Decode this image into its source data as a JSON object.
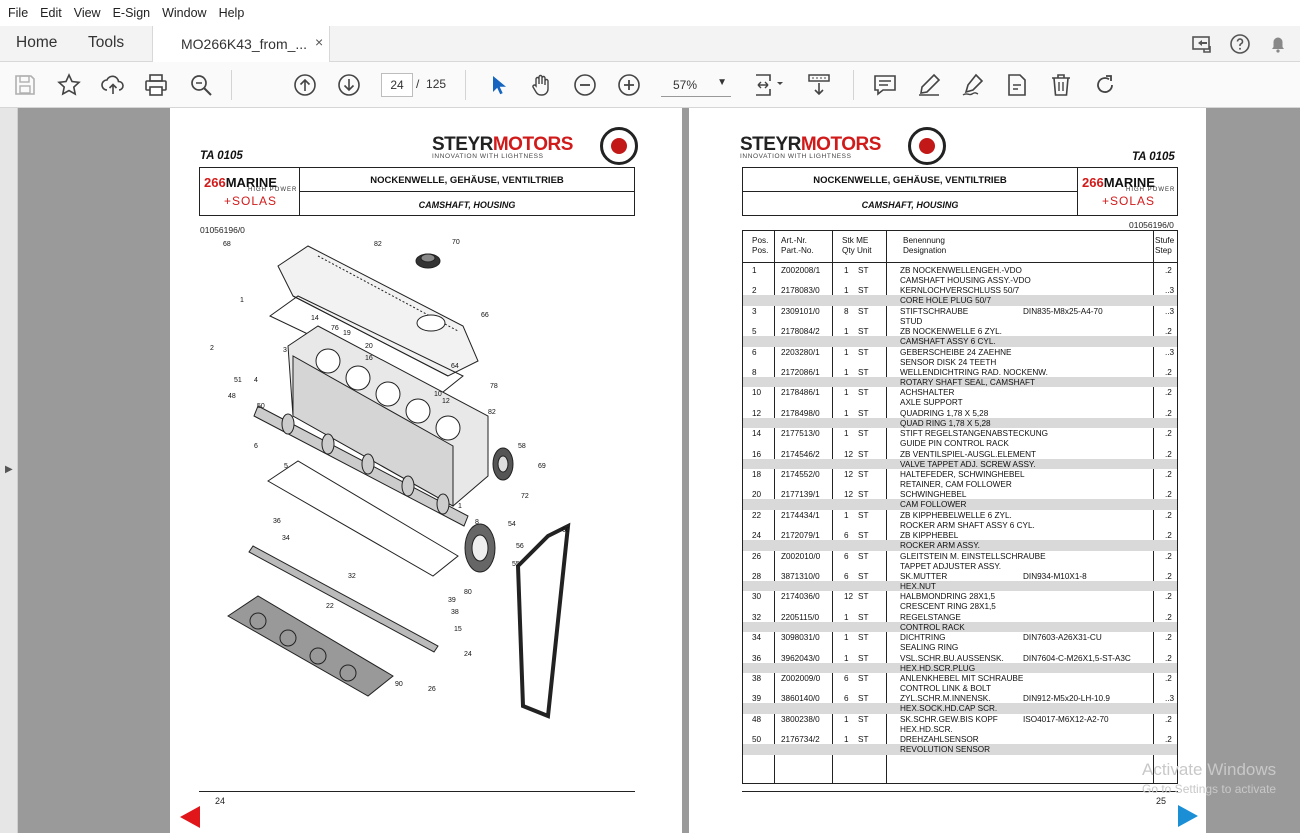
{
  "menu": [
    "File",
    "Edit",
    "View",
    "E-Sign",
    "Window",
    "Help"
  ],
  "tabs": {
    "home": "Home",
    "tools": "Tools",
    "document": "MO266K43_from_...",
    "close": "×"
  },
  "toolbar": {
    "page_current": "24",
    "page_separator": "/",
    "page_total": "125",
    "zoom": "57%",
    "zoom_caret": "▼"
  },
  "left_page": {
    "ta_code": "TA 0105",
    "brand": "STEYR",
    "brand_red": "MOTORS",
    "tagline": "INNOVATION WITH LIGHTNESS",
    "model_num": "266",
    "model_name": "MARINE",
    "model_sub": "HIGH POWER",
    "model_solas": "+SOLAS",
    "title_de": "NOCKENWELLE, GEHÄUSE, VENTILTRIEB",
    "title_en": "CAMSHAFT, HOUSING",
    "doc_no": "01056196/0",
    "page_no": "24",
    "callouts": [
      "68",
      "82",
      "70",
      "1",
      "14",
      "76",
      "19",
      "20",
      "16",
      "66",
      "2",
      "3",
      "64",
      "51",
      "4",
      "48",
      "50",
      "78",
      "10",
      "12",
      "82",
      "6",
      "58",
      "69",
      "5",
      "72",
      "1",
      "8",
      "54",
      "36",
      "34",
      "56",
      "55",
      "60",
      "32",
      "80",
      "22",
      "39",
      "38",
      "15",
      "24",
      "26",
      "90"
    ]
  },
  "right_page": {
    "ta_code": "TA 0105",
    "brand": "STEYR",
    "brand_red": "MOTORS",
    "tagline": "INNOVATION WITH LIGHTNESS",
    "model_num": "266",
    "model_name": "MARINE",
    "model_sub": "HIGH POWER",
    "model_solas": "+SOLAS",
    "title_de": "NOCKENWELLE, GEHÄUSE, VENTILTRIEB",
    "title_en": "CAMSHAFT, HOUSING",
    "doc_no": "01056196/0",
    "page_no": "25",
    "headers": {
      "pos1": "Pos.",
      "pos2": "Pos.",
      "art1": "Art.-Nr.",
      "art2": "Part.-No.",
      "stk1": "Stk  ME",
      "stk2": "Qty  Unit",
      "ben1": "Benennung",
      "ben2": "Designation",
      "stu1": "Stufe",
      "stu2": "Step"
    },
    "rows": [
      {
        "pos": "1",
        "art": "Z002008/1",
        "qty": "1",
        "unit": "ST",
        "de": "ZB NOCKENWELLENGEH.-VDO",
        "en": "CAMSHAFT HOUSING ASSY.-VDO",
        "std": "",
        "step": ".2"
      },
      {
        "pos": "2",
        "art": "2178083/0",
        "qty": "1",
        "unit": "ST",
        "de": "KERNLOCHVERSCHLUSS 50/7",
        "en": "CORE HOLE PLUG 50/7",
        "std": "",
        "step": "..3"
      },
      {
        "pos": "3",
        "art": "2309101/0",
        "qty": "8",
        "unit": "ST",
        "de": "STIFTSCHRAUBE",
        "en": "STUD",
        "std": "DIN835-M8x25-A4-70",
        "step": "..3"
      },
      {
        "pos": "5",
        "art": "2178084/2",
        "qty": "1",
        "unit": "ST",
        "de": "ZB NOCKENWELLE 6 ZYL.",
        "en": "CAMSHAFT ASSY 6 CYL.",
        "std": "",
        "step": ".2"
      },
      {
        "pos": "6",
        "art": "2203280/1",
        "qty": "1",
        "unit": "ST",
        "de": "GEBERSCHEIBE 24 ZAEHNE",
        "en": "SENSOR DISK 24 TEETH",
        "std": "",
        "step": "..3"
      },
      {
        "pos": "8",
        "art": "2172086/1",
        "qty": "1",
        "unit": "ST",
        "de": "WELLENDICHTRING RAD. NOCKENW.",
        "en": "ROTARY SHAFT SEAL, CAMSHAFT",
        "std": "",
        "step": ".2"
      },
      {
        "pos": "10",
        "art": "2178486/1",
        "qty": "1",
        "unit": "ST",
        "de": "ACHSHALTER",
        "en": "AXLE SUPPORT",
        "std": "",
        "step": ".2"
      },
      {
        "pos": "12",
        "art": "2178498/0",
        "qty": "1",
        "unit": "ST",
        "de": "QUADRING 1,78 X 5,28",
        "en": "QUAD RING 1,78 X 5,28",
        "std": "",
        "step": ".2"
      },
      {
        "pos": "14",
        "art": "2177513/0",
        "qty": "1",
        "unit": "ST",
        "de": "STIFT REGELSTANGENABSTECKUNG",
        "en": "GUIDE PIN CONTROL RACK",
        "std": "",
        "step": ".2"
      },
      {
        "pos": "16",
        "art": "2174546/2",
        "qty": "12",
        "unit": "ST",
        "de": "ZB VENTILSPIEL-AUSGL.ELEMENT",
        "en": "VALVE TAPPET ADJ. SCREW ASSY.",
        "std": "",
        "step": ".2"
      },
      {
        "pos": "18",
        "art": "2174552/0",
        "qty": "12",
        "unit": "ST",
        "de": "HALTEFEDER, SCHWINGHEBEL",
        "en": "RETAINER, CAM FOLLOWER",
        "std": "",
        "step": ".2"
      },
      {
        "pos": "20",
        "art": "2177139/1",
        "qty": "12",
        "unit": "ST",
        "de": "SCHWINGHEBEL",
        "en": "CAM FOLLOWER",
        "std": "",
        "step": ".2"
      },
      {
        "pos": "22",
        "art": "2174434/1",
        "qty": "1",
        "unit": "ST",
        "de": "ZB KIPPHEBELWELLE 6 ZYL.",
        "en": "ROCKER ARM SHAFT ASSY 6 CYL.",
        "std": "",
        "step": ".2"
      },
      {
        "pos": "24",
        "art": "2172079/1",
        "qty": "6",
        "unit": "ST",
        "de": "ZB KIPPHEBEL",
        "en": "ROCKER ARM  ASSY.",
        "std": "",
        "step": ".2"
      },
      {
        "pos": "26",
        "art": "Z002010/0",
        "qty": "6",
        "unit": "ST",
        "de": "GLEITSTEIN M. EINSTELLSCHRAUBE",
        "en": "TAPPET ADJUSTER ASSY.",
        "std": "",
        "step": ".2"
      },
      {
        "pos": "28",
        "art": "3871310/0",
        "qty": "6",
        "unit": "ST",
        "de": "SK.MUTTER",
        "en": "HEX.NUT",
        "std": "DIN934-M10X1-8",
        "step": ".2"
      },
      {
        "pos": "30",
        "art": "2174036/0",
        "qty": "12",
        "unit": "ST",
        "de": "HALBMONDRING 28X1,5",
        "en": "CRESCENT RING 28X1,5",
        "std": "",
        "step": ".2"
      },
      {
        "pos": "32",
        "art": "2205115/0",
        "qty": "1",
        "unit": "ST",
        "de": "REGELSTANGE",
        "en": "CONTROL RACK",
        "std": "",
        "step": ".2"
      },
      {
        "pos": "34",
        "art": "3098031/0",
        "qty": "1",
        "unit": "ST",
        "de": "DICHTRING",
        "en": "SEALING RING",
        "std": "DIN7603-A26X31-CU",
        "step": ".2"
      },
      {
        "pos": "36",
        "art": "3962043/0",
        "qty": "1",
        "unit": "ST",
        "de": "VSL.SCHR.BU.AUSSENSK.",
        "en": "HEX.HD.SCR.PLUG",
        "std": "DIN7604-C-M26X1,5-ST-A3C",
        "step": ".2"
      },
      {
        "pos": "38",
        "art": "Z002009/0",
        "qty": "6",
        "unit": "ST",
        "de": "ANLENKHEBEL MIT SCHRAUBE",
        "en": "CONTROL LINK & BOLT",
        "std": "",
        "step": ".2"
      },
      {
        "pos": "39",
        "art": "3860140/0",
        "qty": "6",
        "unit": "ST",
        "de": "ZYL.SCHR.M.INNENSK.",
        "en": "HEX.SOCK.HD.CAP SCR.",
        "std": "DIN912-M5x20-LH-10.9",
        "step": "..3"
      },
      {
        "pos": "48",
        "art": "3800238/0",
        "qty": "1",
        "unit": "ST",
        "de": "SK.SCHR.GEW.BIS KOPF",
        "en": "HEX.HD.SCR.",
        "std": "ISO4017-M6X12-A2-70",
        "step": ".2"
      },
      {
        "pos": "50",
        "art": "2176734/2",
        "qty": "1",
        "unit": "ST",
        "de": "DREHZAHLSENSOR",
        "en": "REVOLUTION SENSOR",
        "std": "",
        "step": ".2"
      }
    ]
  },
  "watermark": {
    "line1": "Activate Windows",
    "line2": "Go to Settings to activate"
  },
  "colors": {
    "brand_red": "#d11a1a",
    "nav_red": "#e0161a",
    "nav_blue": "#1a8fd6",
    "select_blue": "#1565c0"
  }
}
